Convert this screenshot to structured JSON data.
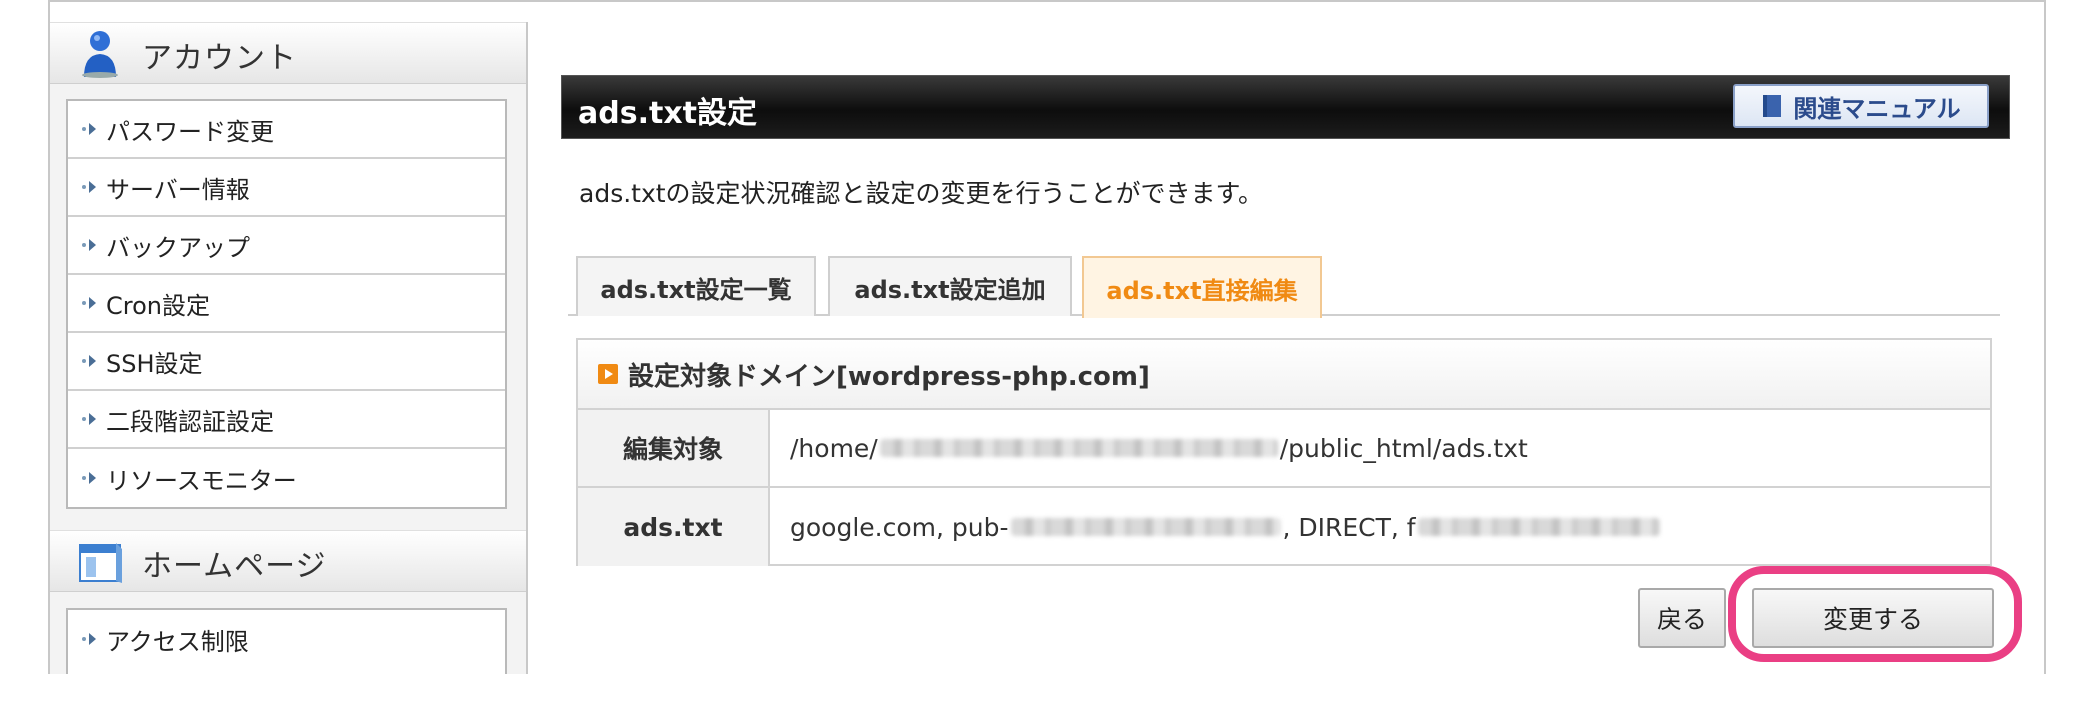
{
  "sidebar": {
    "sections": [
      {
        "title": "アカウント",
        "icon": "user-icon",
        "items": [
          "パスワード変更",
          "サーバー情報",
          "バックアップ",
          "Cron設定",
          "SSH設定",
          "二段階認証設定",
          "リソースモニター"
        ]
      },
      {
        "title": "ホームページ",
        "icon": "browser-window-icon",
        "items": [
          "アクセス制限"
        ]
      }
    ]
  },
  "header": {
    "title": "ads.txt設定",
    "manual_label": "関連マニュアル",
    "manual_icon": "book-icon"
  },
  "description": "ads.txtの設定状況確認と設定の変更を行うことができます。",
  "tabs": [
    {
      "label": "ads.txt設定一覧",
      "active": false
    },
    {
      "label": "ads.txt設定追加",
      "active": false
    },
    {
      "label": "ads.txt直接編集",
      "active": true
    }
  ],
  "panel": {
    "heading": "設定対象ドメイン[wordpress-php.com]",
    "rows": [
      {
        "label": "編集対象",
        "value_prefix": "/home/",
        "value_suffix": "/public_html/ads.txt"
      },
      {
        "label": "ads.txt",
        "value_prefix": "google.com, pub-",
        "value_middle": ", DIRECT, f",
        "value_suffix": ""
      }
    ]
  },
  "buttons": {
    "back": "戻る",
    "submit": "変更する"
  },
  "colors": {
    "active_tab_text": "#f08a13",
    "highlight": "#ea3f84",
    "manual_text": "#2b4b8c"
  }
}
